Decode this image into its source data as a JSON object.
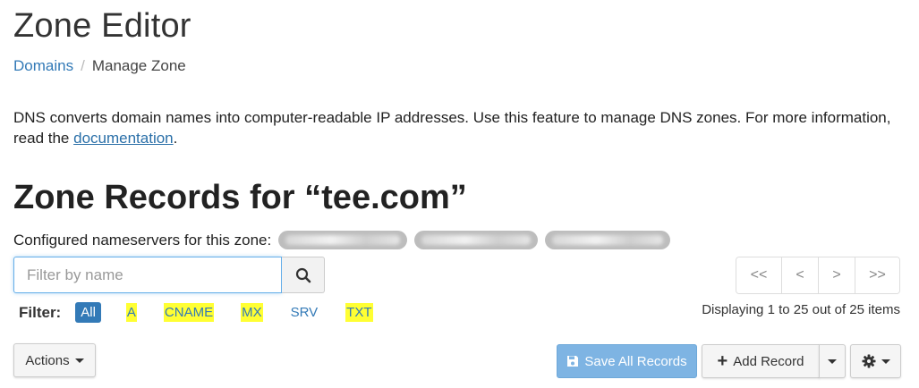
{
  "header": {
    "title": "Zone Editor",
    "breadcrumb": {
      "link": "Domains",
      "separator": "/",
      "current": "Manage Zone"
    }
  },
  "description": {
    "text": "DNS converts domain names into computer-readable IP addresses. Use this feature to manage DNS zones. For more information, read the ",
    "link_label": "documentation",
    "suffix": "."
  },
  "zone": {
    "heading": "Zone Records for “tee.com”",
    "nameservers_label": "Configured nameservers for this zone:"
  },
  "search": {
    "placeholder": "Filter by name",
    "value": ""
  },
  "pager": {
    "first": "<<",
    "prev": "<",
    "next": ">",
    "last": ">>"
  },
  "filter": {
    "label": "Filter:",
    "chips": [
      "All",
      "A",
      "CNAME",
      "MX",
      "SRV",
      "TXT"
    ]
  },
  "display_count": "Displaying 1 to 25 out of 25 items",
  "toolbar": {
    "actions_label": "Actions",
    "save_label": "Save All Records",
    "add_label": "Add Record"
  },
  "icons": {
    "search": "search-icon",
    "save": "floppy-disk-icon",
    "add": "plus-icon",
    "settings": "gear-icon"
  },
  "colors": {
    "accent": "#337ab7",
    "highlight": "#ffff33",
    "save_button": "#7eb4e3"
  }
}
